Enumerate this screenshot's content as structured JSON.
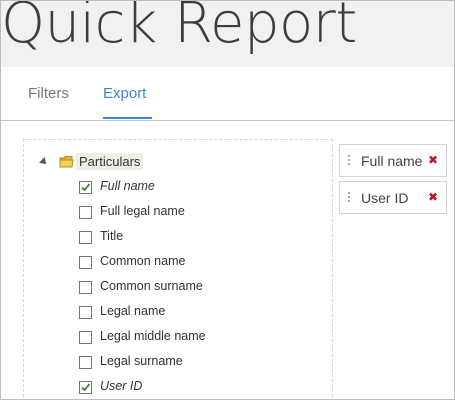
{
  "header": {
    "title": "Quick Report"
  },
  "tabs": [
    {
      "label": "Filters",
      "active": false
    },
    {
      "label": "Export",
      "active": true
    }
  ],
  "tree": {
    "root": {
      "label": "Particulars",
      "icon": "folder-icon",
      "expanded": true
    },
    "items": [
      {
        "label": "Full name",
        "checked": true
      },
      {
        "label": "Full legal name",
        "checked": false
      },
      {
        "label": "Title",
        "checked": false
      },
      {
        "label": "Common name",
        "checked": false
      },
      {
        "label": "Common surname",
        "checked": false
      },
      {
        "label": "Legal name",
        "checked": false
      },
      {
        "label": "Legal middle name",
        "checked": false
      },
      {
        "label": "Legal surname",
        "checked": false
      },
      {
        "label": "User ID",
        "checked": true
      }
    ]
  },
  "selected_columns": [
    {
      "label": "Full name",
      "remove_icon": "✖"
    },
    {
      "label": "User ID",
      "remove_icon": "✖"
    }
  ],
  "colors": {
    "accent": "#3a87d6",
    "remove": "#c0171a",
    "check": "#3a8a2a"
  }
}
